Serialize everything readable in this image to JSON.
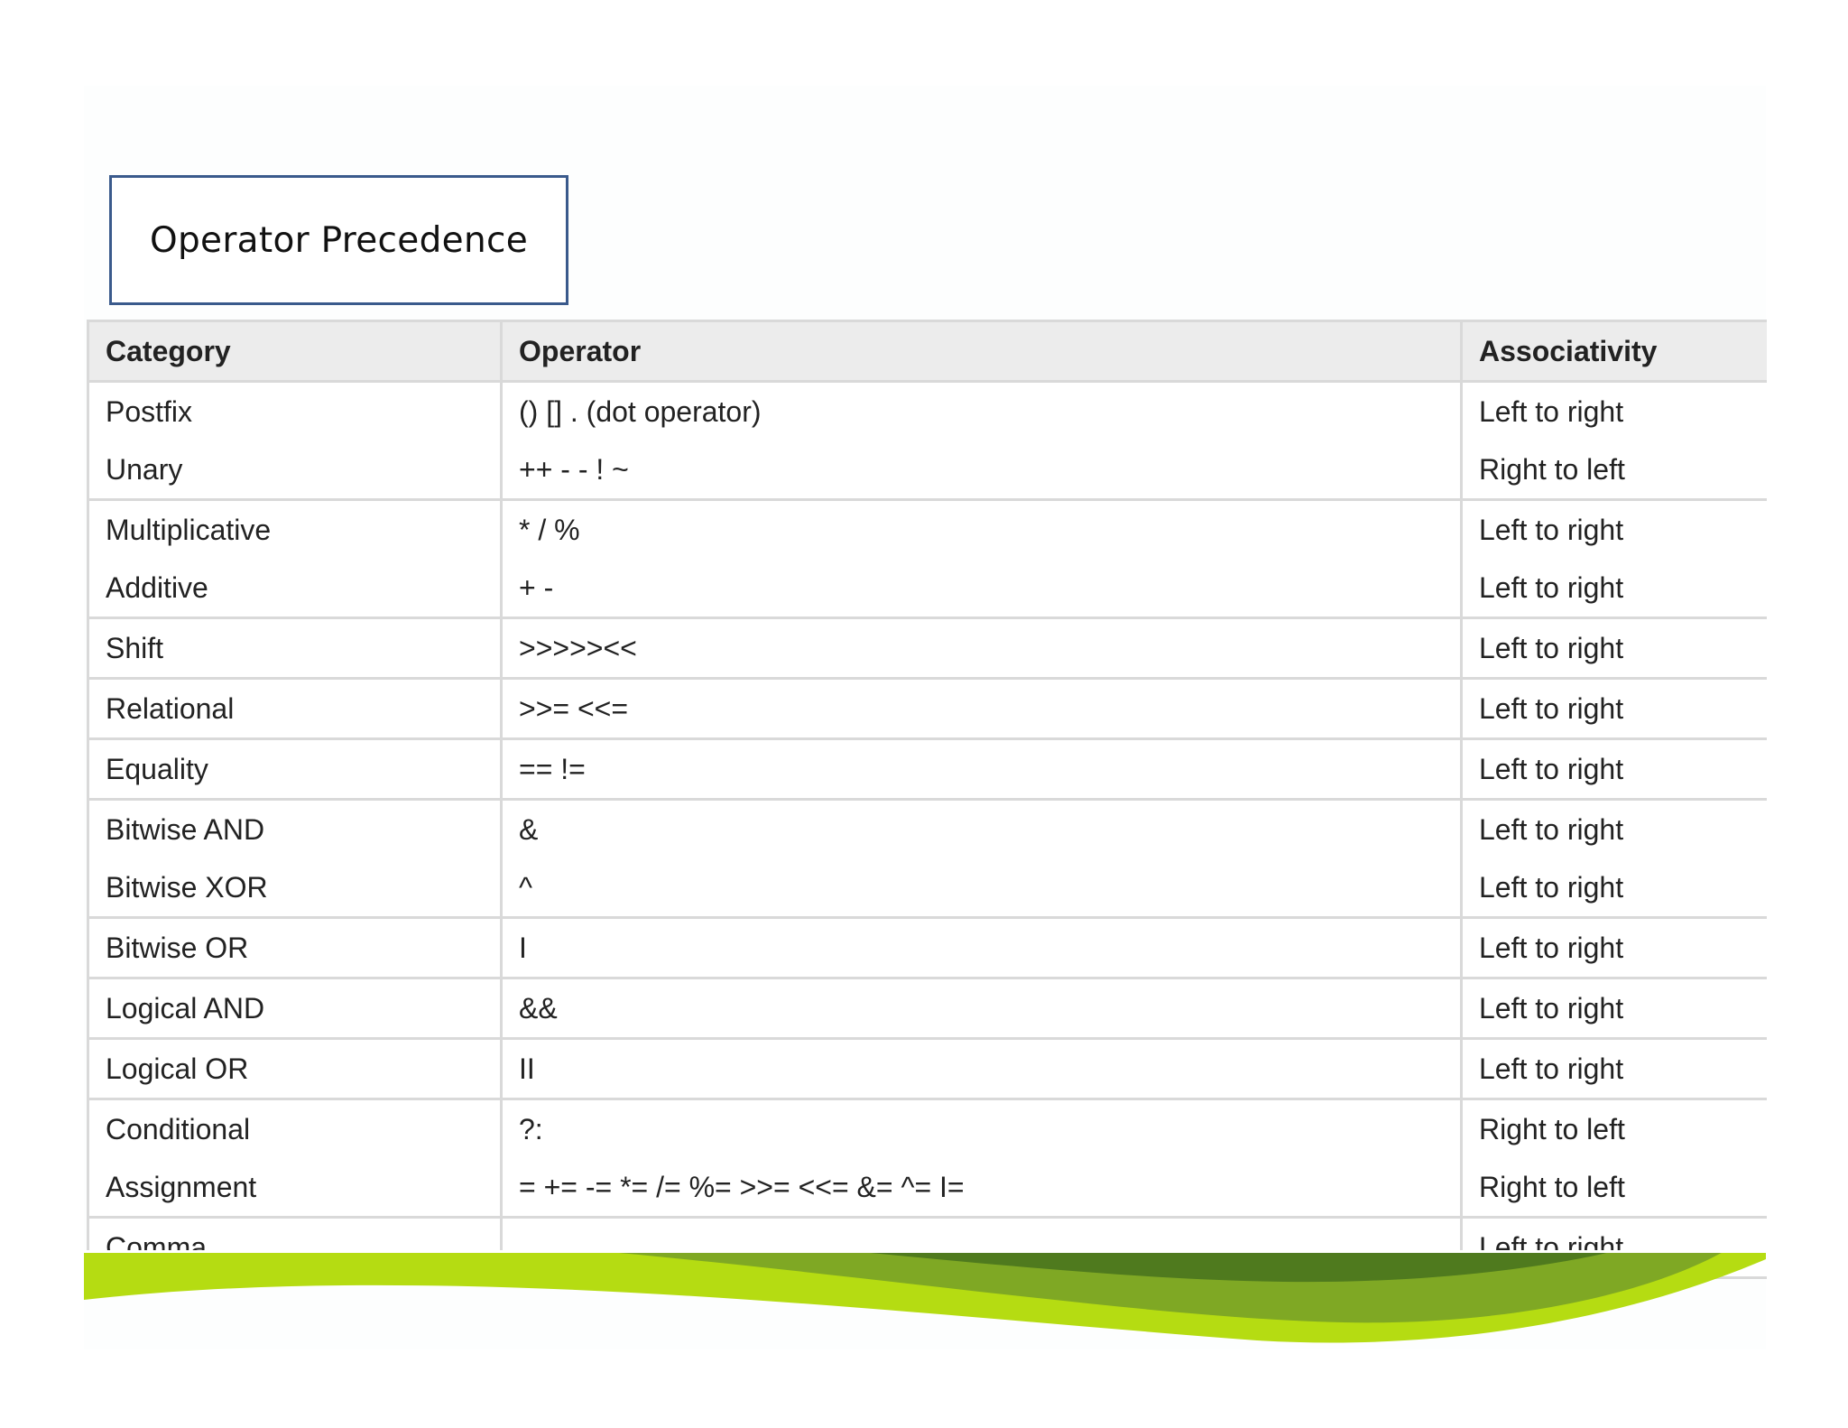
{
  "title": "Operator Precedence",
  "table": {
    "headers": [
      "Category",
      "Operator",
      "Associativity"
    ],
    "rows": [
      {
        "category": "Postfix",
        "operator": "() [] . (dot operator)",
        "associativity": "Left to right",
        "group_end": false
      },
      {
        "category": "Unary",
        "operator": "++ - - ! ~",
        "associativity": "Right to left",
        "group_end": true
      },
      {
        "category": "Multiplicative",
        "operator": "* / %",
        "associativity": "Left to right",
        "group_end": false
      },
      {
        "category": "Additive",
        "operator": "+ -",
        "associativity": "Left to right",
        "group_end": true
      },
      {
        "category": "Shift",
        "operator": ">>>>><<",
        "associativity": "Left to right",
        "group_end": true
      },
      {
        "category": "Relational",
        "operator": ">>= <<=",
        "associativity": "Left to right",
        "group_end": true
      },
      {
        "category": "Equality",
        "operator": "== !=",
        "associativity": "Left to right",
        "group_end": true
      },
      {
        "category": "Bitwise AND",
        "operator": "&",
        "associativity": "Left to right",
        "group_end": false
      },
      {
        "category": "Bitwise XOR",
        "operator": "^",
        "associativity": "Left to right",
        "group_end": true
      },
      {
        "category": "Bitwise OR",
        "operator": "I",
        "associativity": "Left to right",
        "group_end": true
      },
      {
        "category": "Logical AND",
        "operator": "&&",
        "associativity": "Left to right",
        "group_end": true
      },
      {
        "category": "Logical OR",
        "operator": "II",
        "associativity": "Left to right",
        "group_end": true
      },
      {
        "category": "Conditional",
        "operator": "?:",
        "associativity": "Right to left",
        "group_end": false
      },
      {
        "category": "Assignment",
        "operator": "= += -= *= /= %= >>= <<= &= ^= I=",
        "associativity": "Right to left",
        "group_end": true
      },
      {
        "category": "Comma",
        "operator": ",",
        "associativity": "Left to right",
        "group_end": true
      }
    ]
  },
  "colors": {
    "title_border": "#3a5a8c",
    "header_bg": "#ececec",
    "grid": "#d9d9d9",
    "wave_light": "#b5dc12",
    "wave_mid": "#7fa824",
    "wave_dark": "#4f7a1e"
  }
}
